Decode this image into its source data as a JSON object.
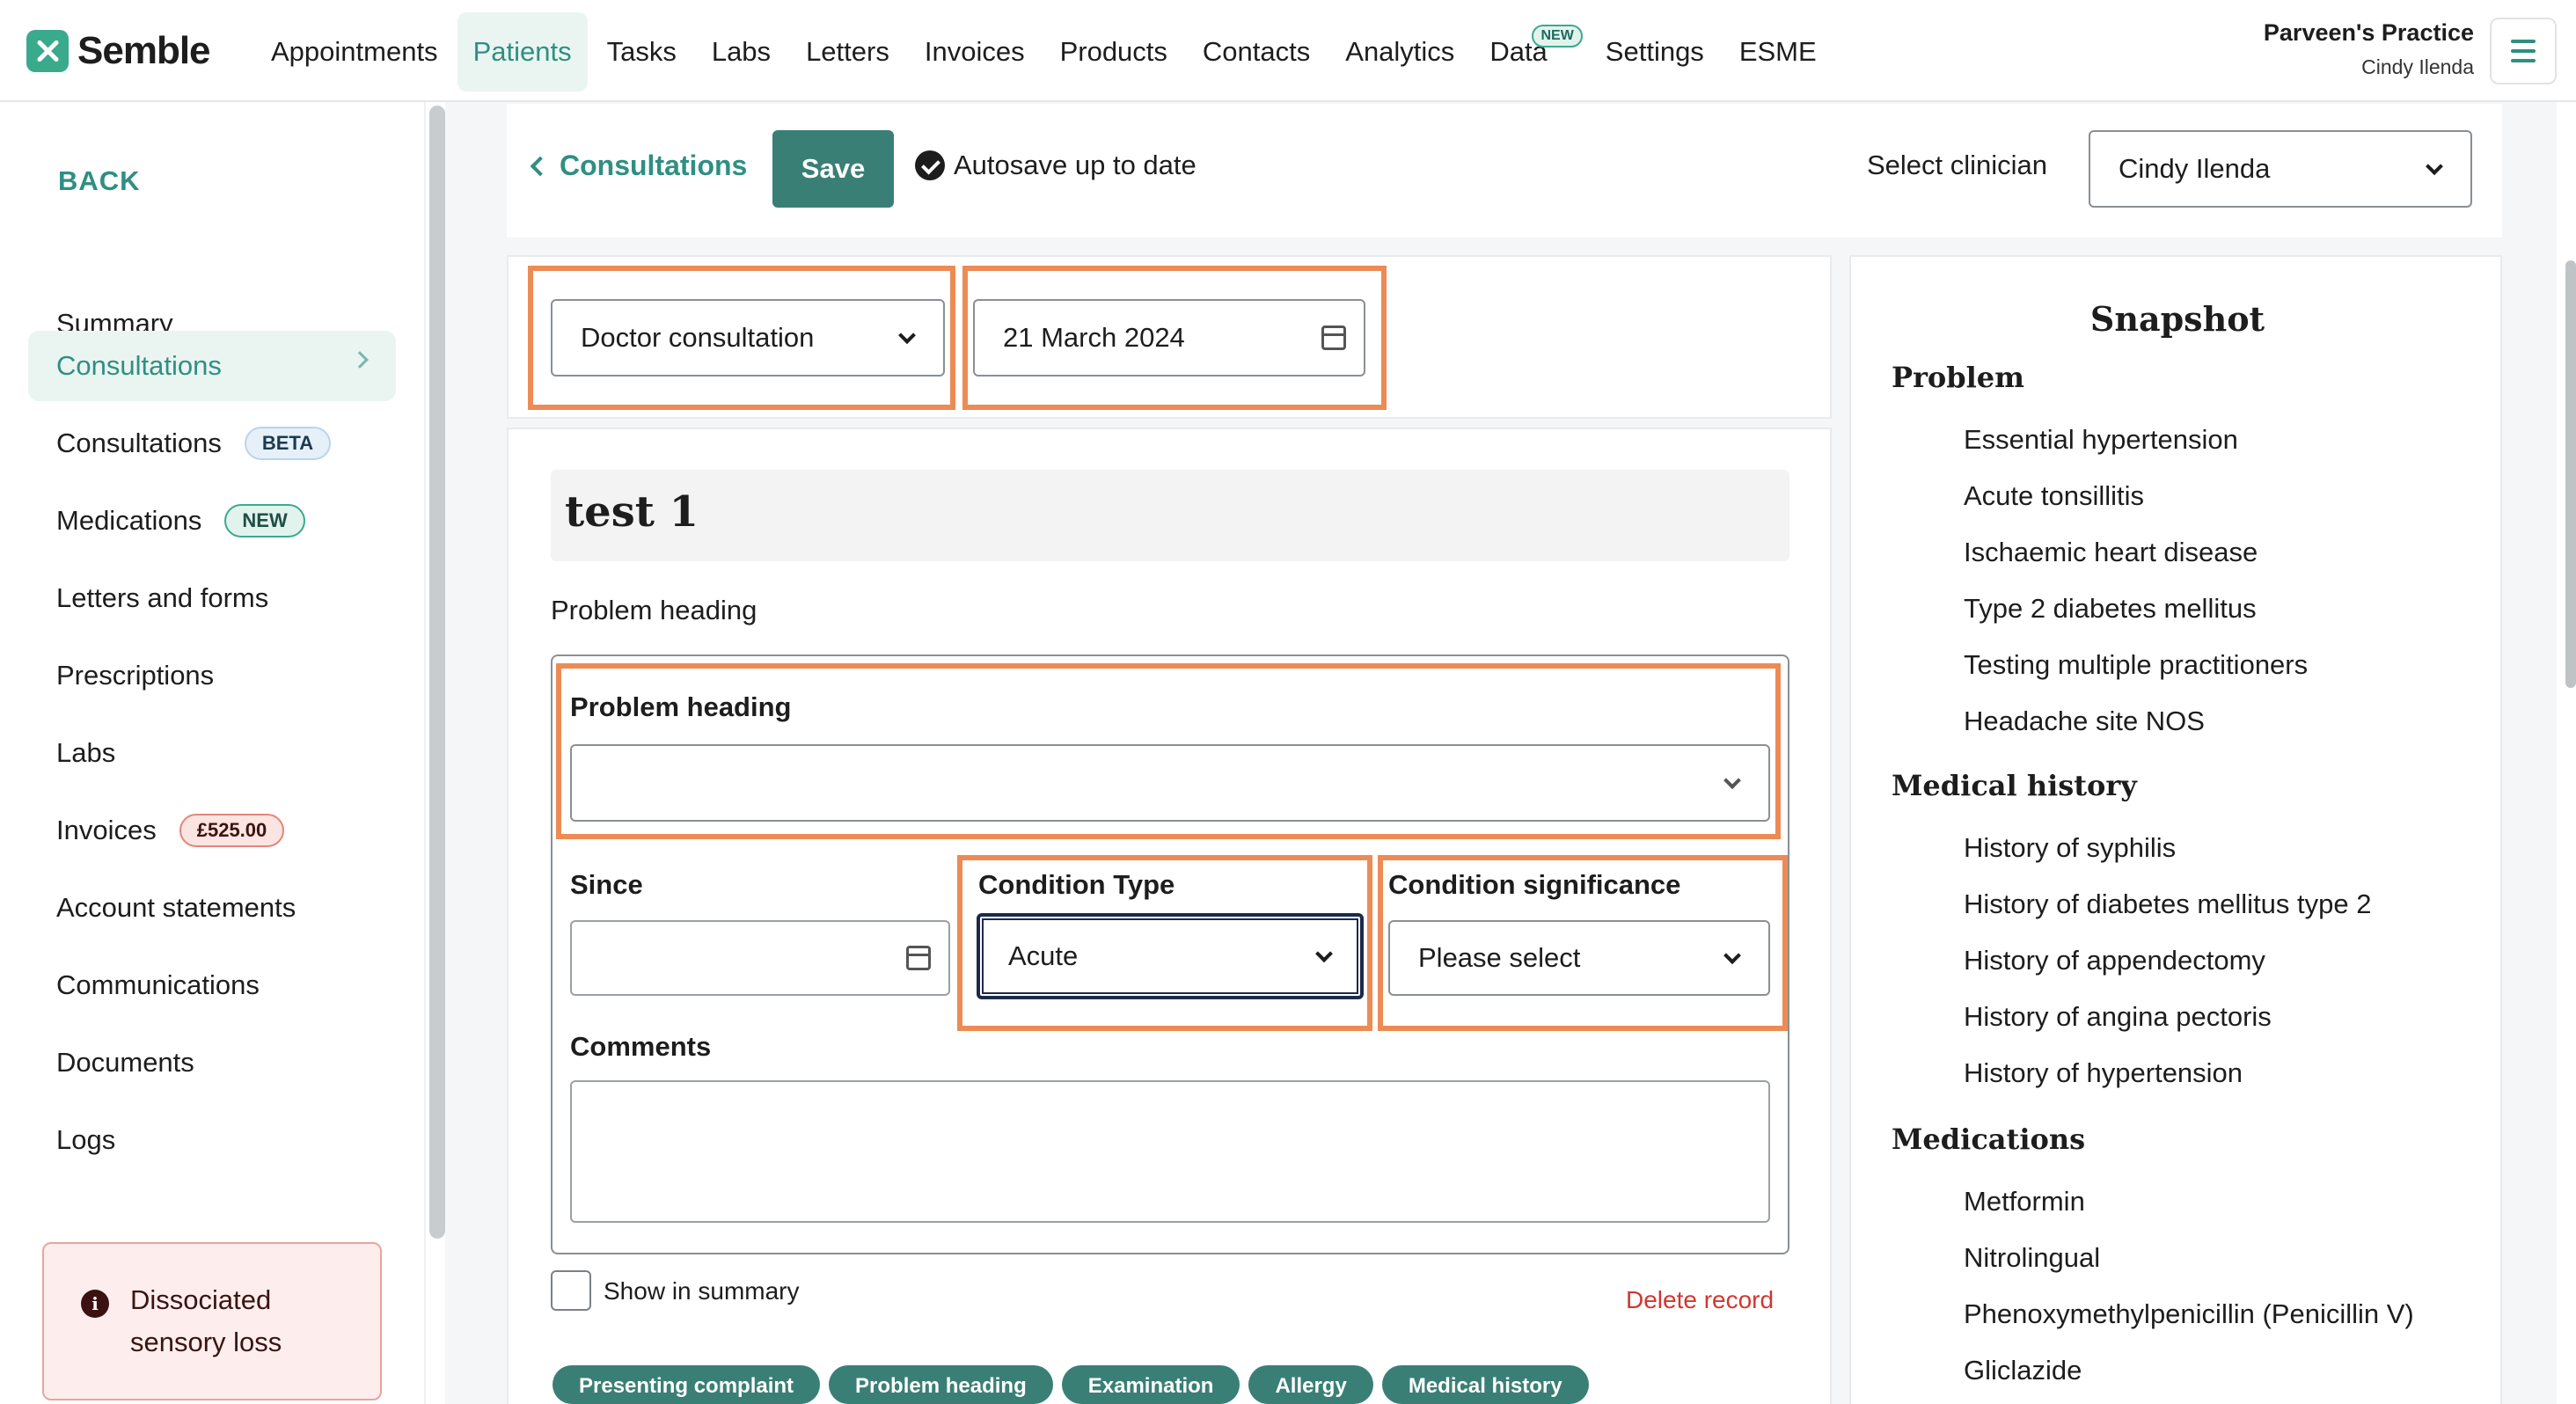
{
  "app": {
    "name": "Semble"
  },
  "nav": {
    "items": [
      "Appointments",
      "Patients",
      "Tasks",
      "Labs",
      "Letters",
      "Invoices",
      "Products",
      "Contacts",
      "Analytics",
      "Data",
      "Settings",
      "ESME"
    ],
    "active": "Patients",
    "data_badge": "NEW"
  },
  "practice": {
    "name": "Parveen's Practice",
    "user": "Cindy Ilenda"
  },
  "sidebar": {
    "back": "BACK",
    "items": [
      {
        "label": "Summary"
      },
      {
        "label": "Consultations"
      },
      {
        "label": "Consultations",
        "badge": "BETA"
      },
      {
        "label": "Medications",
        "badge": "NEW"
      },
      {
        "label": "Letters and forms"
      },
      {
        "label": "Prescriptions"
      },
      {
        "label": "Labs"
      },
      {
        "label": "Invoices",
        "badge": "£525.00"
      },
      {
        "label": "Account statements"
      },
      {
        "label": "Communications"
      },
      {
        "label": "Documents"
      },
      {
        "label": "Logs"
      }
    ],
    "alert": "Dissociated sensory loss"
  },
  "toolbar": {
    "breadcrumb": "Consultations",
    "save": "Save",
    "autosave": "Autosave up to date",
    "clinician_label": "Select clinician",
    "clinician_value": "Cindy Ilenda"
  },
  "consultation": {
    "type": "Doctor consultation",
    "date": "21 March 2024",
    "title": "test 1",
    "section_label": "Problem heading",
    "problem_heading_label": "Problem heading",
    "problem_heading_value": "",
    "since_label": "Since",
    "condition_type_label": "Condition Type",
    "condition_type_value": "Acute",
    "condition_significance_label": "Condition significance",
    "condition_significance_value": "Please select",
    "comments_label": "Comments",
    "show_in_summary": "Show in summary",
    "delete": "Delete record",
    "tags": [
      "Presenting complaint",
      "Problem heading",
      "Examination",
      "Allergy",
      "Medical history"
    ]
  },
  "snapshot": {
    "title": "Snapshot",
    "problem_heading": "Problem",
    "problems": [
      "Essential hypertension",
      "Acute tonsillitis",
      "Ischaemic heart disease",
      "Type 2 diabetes mellitus",
      "Testing multiple practitioners",
      "Headache site NOS"
    ],
    "history_heading": "Medical history",
    "history": [
      "History of syphilis",
      "History of diabetes mellitus type 2",
      "History of appendectomy",
      "History of angina pectoris",
      "History of hypertension"
    ],
    "medications_heading": "Medications",
    "medications": [
      "Metformin",
      "Nitrolingual",
      "Phenoxymethylpenicillin (Penicillin V)",
      "Gliclazide"
    ]
  },
  "colors": {
    "accent": "#2f8f82",
    "highlight": "#ed8b55",
    "danger": "#d4362f"
  }
}
